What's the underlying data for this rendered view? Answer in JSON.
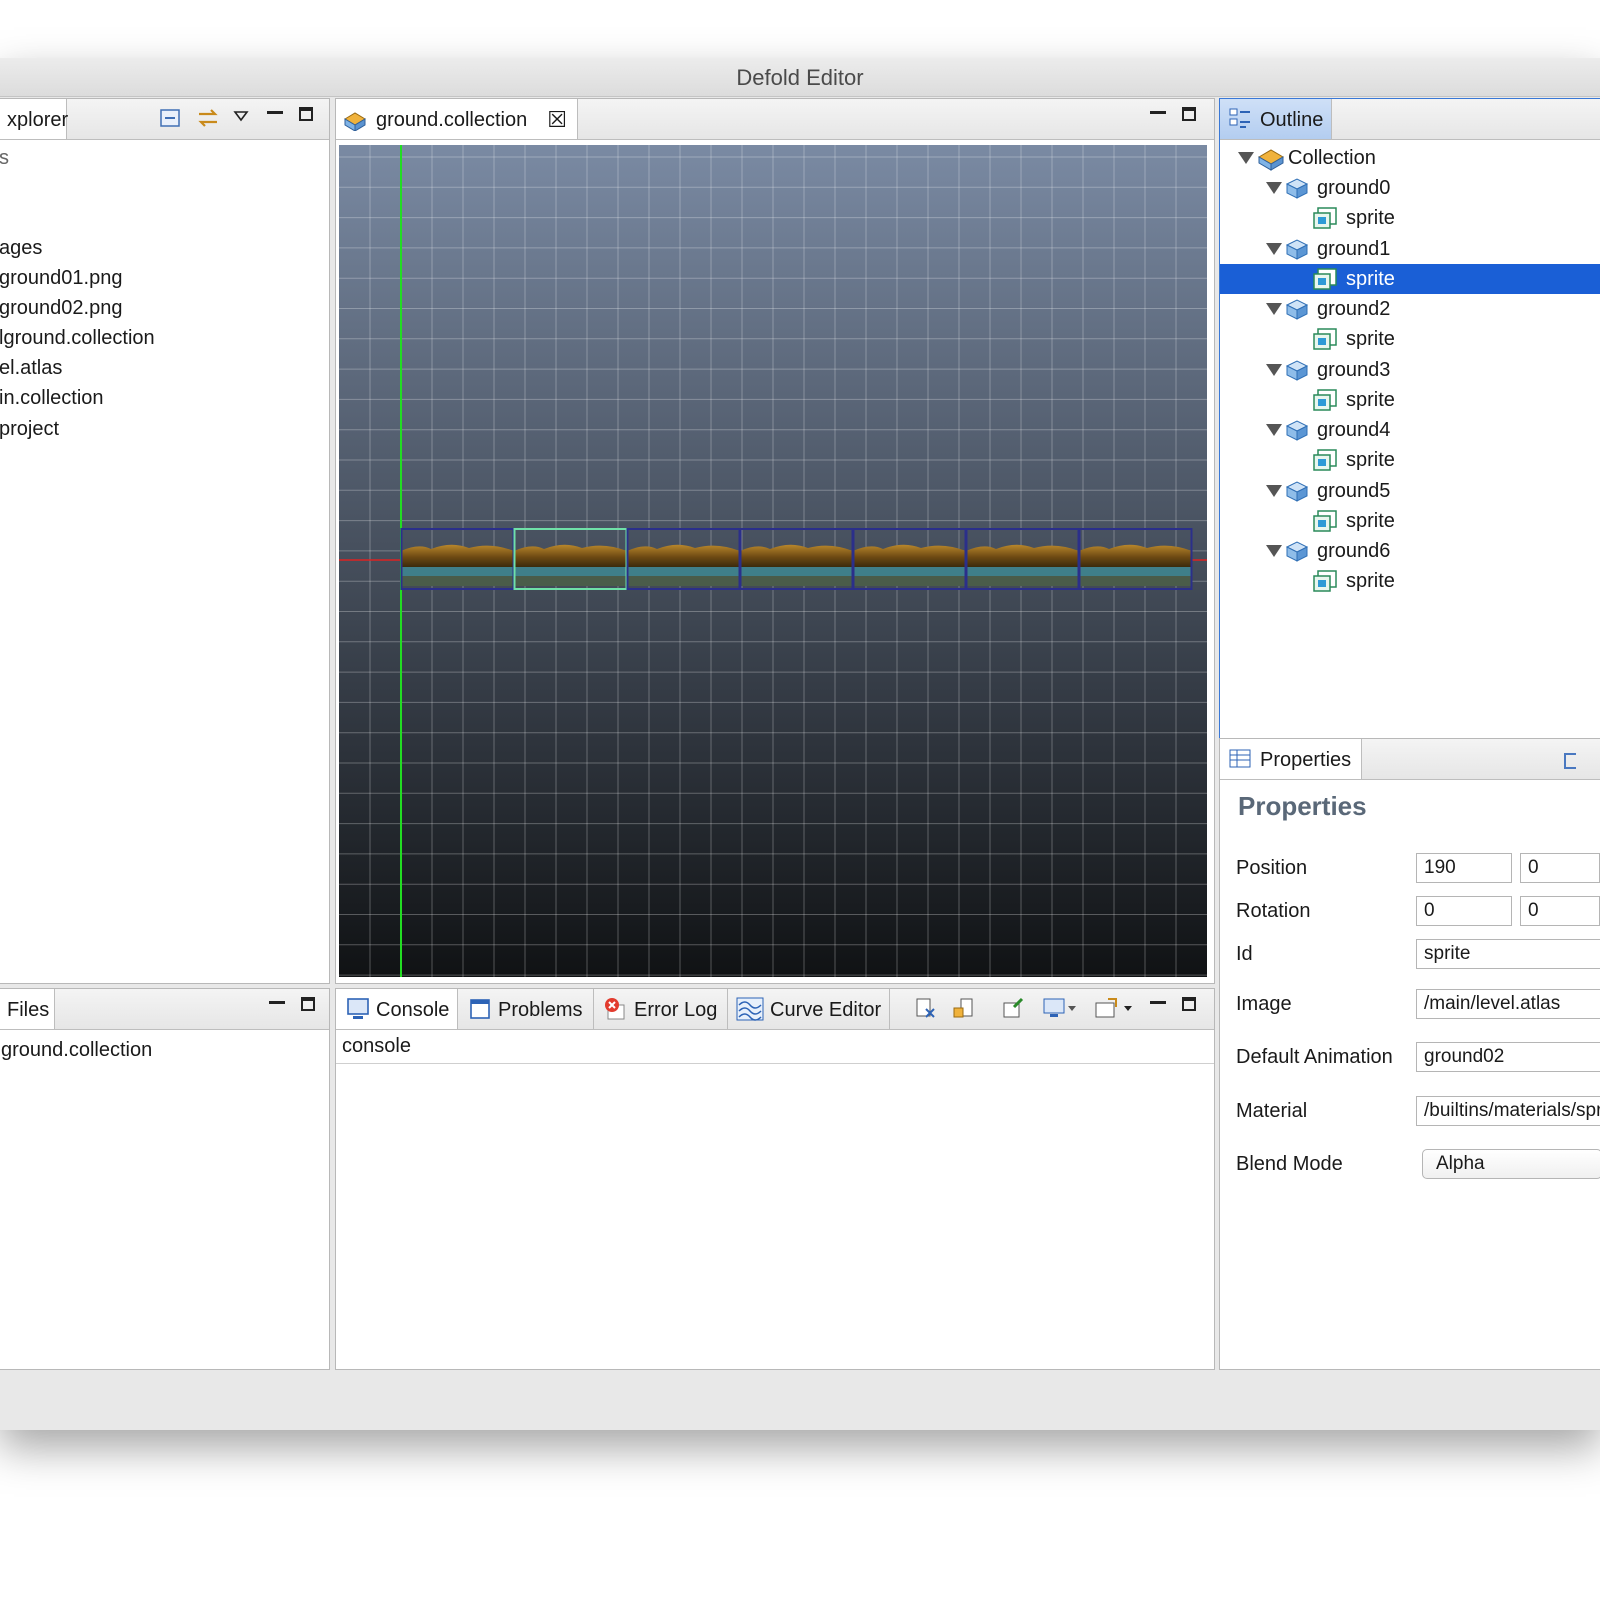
{
  "window": {
    "title": "Defold Editor"
  },
  "explorer": {
    "tab_label": "xplorer",
    "items": [
      "s",
      "ages",
      "ground01.png",
      "ground02.png",
      "lground.collection",
      "el.atlas",
      "in.collection",
      "project"
    ]
  },
  "files": {
    "tab_label": "Files",
    "items": [
      "ground.collection"
    ]
  },
  "editor": {
    "tab_label": "ground.collection",
    "tile_count": 7,
    "selected_tile_index": 1
  },
  "outline": {
    "tab_label": "Outline",
    "collection_label": "Collection",
    "groups": [
      {
        "label": "ground0",
        "child": "sprite",
        "selected": false
      },
      {
        "label": "ground1",
        "child": "sprite",
        "selected": true
      },
      {
        "label": "ground2",
        "child": "sprite",
        "selected": false
      },
      {
        "label": "ground3",
        "child": "sprite",
        "selected": false
      },
      {
        "label": "ground4",
        "child": "sprite",
        "selected": false
      },
      {
        "label": "ground5",
        "child": "sprite",
        "selected": false
      },
      {
        "label": "ground6",
        "child": "sprite",
        "selected": false
      }
    ]
  },
  "properties": {
    "tab_label": "Properties",
    "heading": "Properties",
    "position": {
      "label": "Position",
      "x": "190",
      "y": "0"
    },
    "rotation": {
      "label": "Rotation",
      "x": "0",
      "y": "0"
    },
    "id": {
      "label": "Id",
      "value": "sprite"
    },
    "image": {
      "label": "Image",
      "value": "/main/level.atlas"
    },
    "default_animation": {
      "label": "Default Animation",
      "value": "ground02"
    },
    "material": {
      "label": "Material",
      "value": "/builtins/materials/sprite.material"
    },
    "blend_mode": {
      "label": "Blend Mode",
      "value": "Alpha"
    }
  },
  "bottom": {
    "tabs": [
      "Console",
      "Problems",
      "Error Log",
      "Curve Editor"
    ],
    "console_header": "console"
  },
  "colors": {
    "selection": "#1a5fd6",
    "grid_top": "#7a8aa3",
    "grid_bottom": "#101214",
    "y_axis": "#22dd22",
    "x_axis": "#dd2222"
  }
}
